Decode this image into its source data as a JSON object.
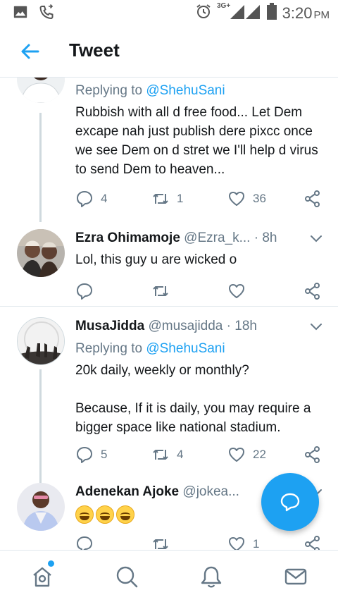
{
  "status_bar": {
    "time": "3:20",
    "ampm": "PM",
    "network": "3G+"
  },
  "header": {
    "title": "Tweet"
  },
  "tweets": [
    {
      "reply_prefix": "Replying to ",
      "reply_to": "@ShehuSani",
      "text": "Rubbish with all d free food... Let Dem excape nah just publish dere pixcc once we see Dem on d stret we I'll help d virus to send Dem to heaven...",
      "replies": "4",
      "retweets": "1",
      "likes": "36"
    },
    {
      "name": "Ezra Ohimamoje",
      "handle": "@Ezra_k...",
      "time": "· 8h",
      "text": "Lol, this guy u are wicked o",
      "replies": "",
      "retweets": "",
      "likes": ""
    },
    {
      "name": "MusaJidda",
      "handle": "@musajidda",
      "time": "· 18h",
      "reply_prefix": "Replying to ",
      "reply_to": "@ShehuSani",
      "text": "20k daily, weekly or monthly?\n\nBecause, If it is daily, you may require a bigger space like national stadium.",
      "replies": "5",
      "retweets": "4",
      "likes": "22"
    },
    {
      "name": "Adenekan Ajoke",
      "handle": "@jokea...",
      "replies": "",
      "retweets": "",
      "likes": "1"
    }
  ],
  "colors": {
    "accent": "#1da1f2",
    "muted": "#657786",
    "text": "#14171a",
    "divider": "#e1e8ed"
  },
  "icons": [
    "gallery-icon",
    "phone-icon",
    "alarm-icon",
    "signal-icon",
    "battery-icon",
    "back-arrow-icon",
    "reply-icon",
    "retweet-icon",
    "like-icon",
    "share-icon",
    "chevron-down-icon",
    "compose-message-icon",
    "home-icon",
    "search-icon",
    "notifications-icon",
    "messages-icon"
  ]
}
